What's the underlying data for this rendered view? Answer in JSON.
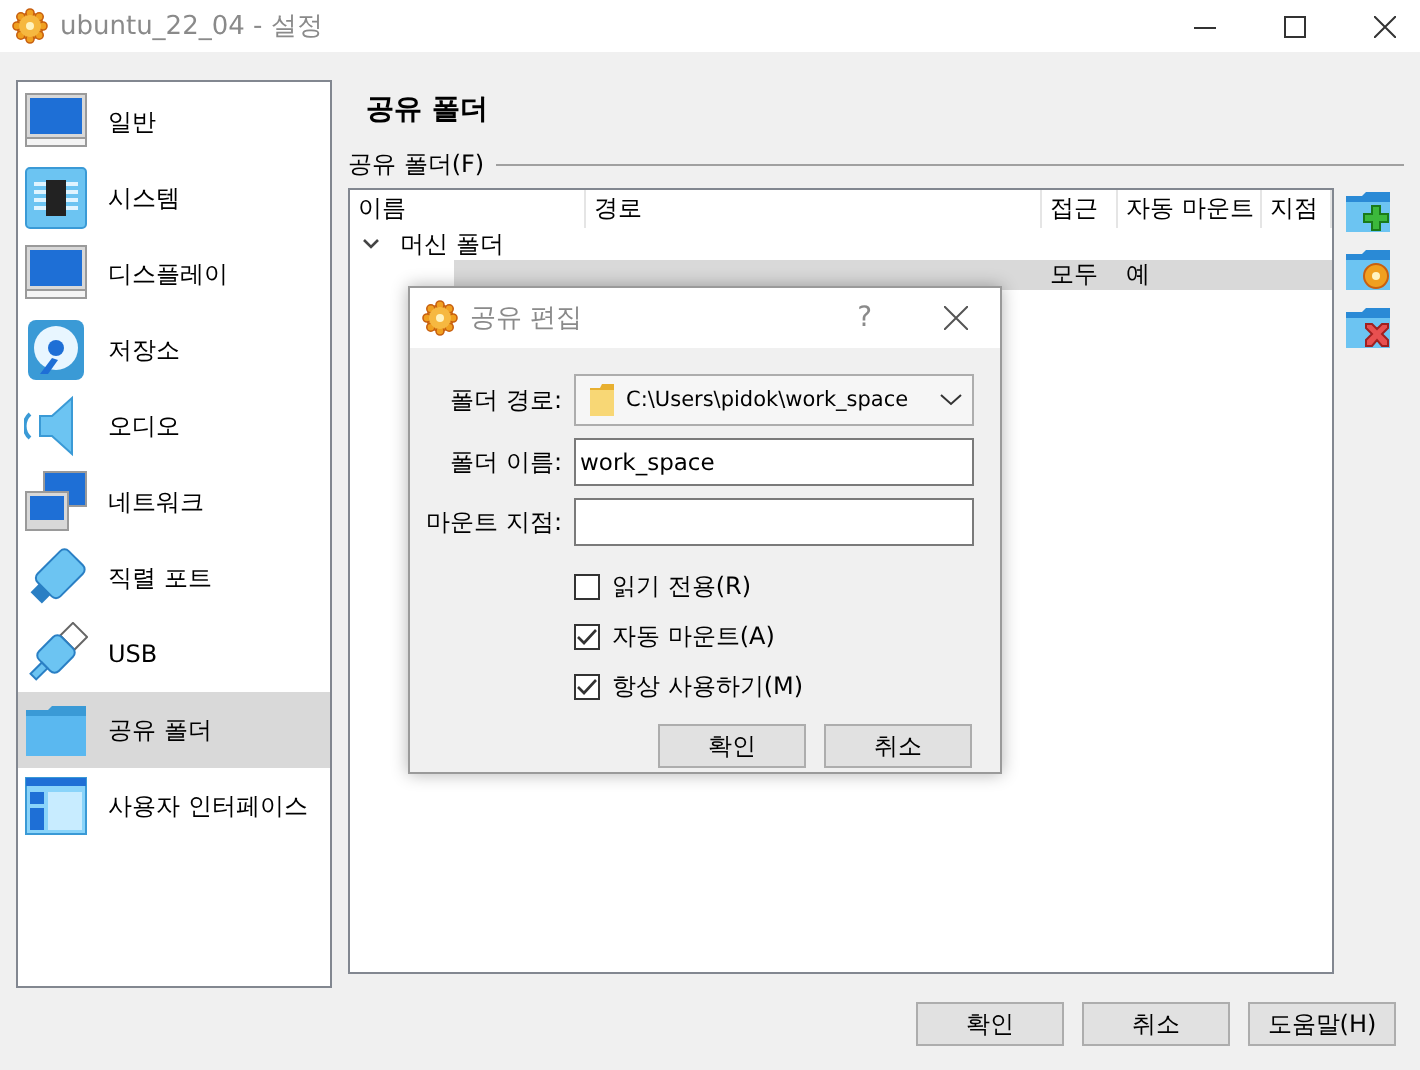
{
  "window": {
    "title": "ubuntu_22_04 - 설정"
  },
  "sidebar": {
    "items": [
      {
        "label": "일반",
        "selected": false
      },
      {
        "label": "시스템",
        "selected": false
      },
      {
        "label": "디스플레이",
        "selected": false
      },
      {
        "label": "저장소",
        "selected": false
      },
      {
        "label": "오디오",
        "selected": false
      },
      {
        "label": "네트워크",
        "selected": false
      },
      {
        "label": "직렬 포트",
        "selected": false
      },
      {
        "label": "USB",
        "selected": false
      },
      {
        "label": "공유 폴더",
        "selected": true
      },
      {
        "label": "사용자 인터페이스",
        "selected": false
      }
    ]
  },
  "page": {
    "heading": "공유 폴더",
    "group_label": "공유 폴더(F)"
  },
  "table": {
    "columns": [
      "이름",
      "경로",
      "접근",
      "자동 마운트",
      "지점"
    ],
    "groups": [
      {
        "label": "머신 폴더",
        "expanded": true,
        "rows": [
          {
            "access": "모두",
            "auto_mount": "예",
            "selected": true
          }
        ]
      }
    ]
  },
  "buttons": [
    "확인",
    "취소",
    "도움말(H)"
  ],
  "dialog": {
    "title": "공유 편집",
    "help": "?",
    "fields": [
      {
        "label": "폴더 경로:",
        "kind": "combo",
        "value": "C:\\Users\\pidok\\work_space"
      },
      {
        "label": "폴더 이름:",
        "kind": "text",
        "value": "work_space"
      },
      {
        "label": "마운트 지점:",
        "kind": "text"
      }
    ],
    "checkboxes": [
      {
        "label": "읽기 전용(R)",
        "checked": false
      },
      {
        "label": "자동 마운트(A)",
        "checked": true
      },
      {
        "label": "항상 사용하기(M)",
        "checked": true
      }
    ],
    "buttons": [
      "확인",
      "취소"
    ]
  }
}
